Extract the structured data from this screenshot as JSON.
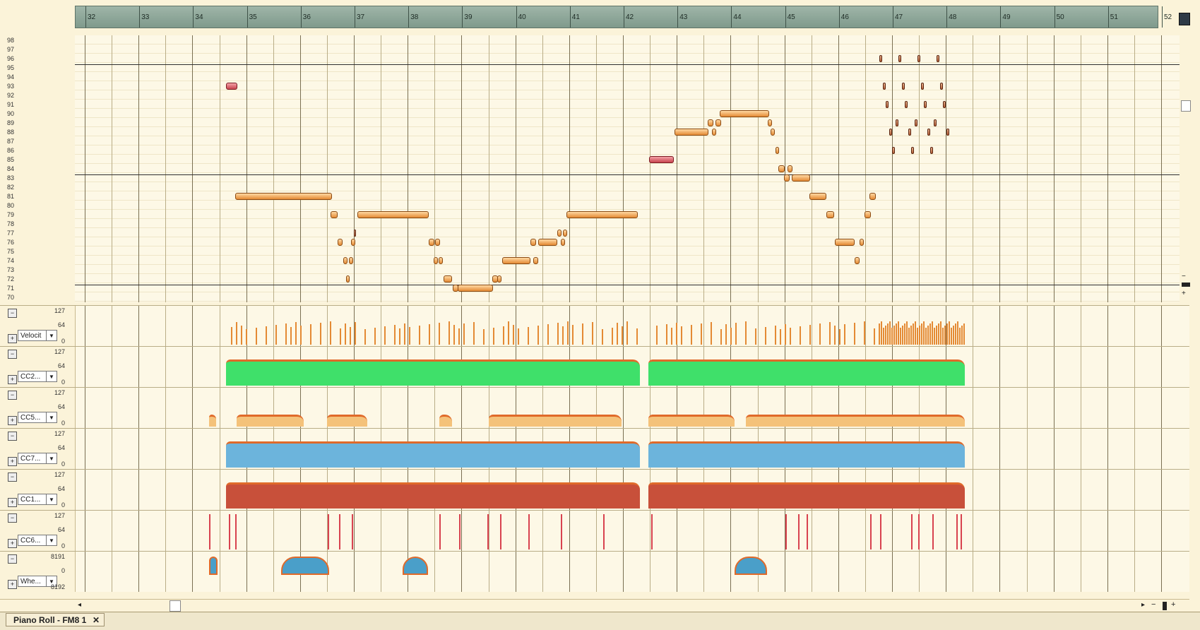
{
  "ruler": {
    "bars": [
      "32",
      "33",
      "34",
      "35",
      "36",
      "37",
      "38",
      "39",
      "40",
      "41",
      "42",
      "43",
      "44",
      "45",
      "46",
      "47",
      "48",
      "49",
      "50",
      "51",
      "52"
    ]
  },
  "piano_roll": {
    "pitch_labels": [
      "98",
      "97",
      "96",
      "95",
      "94",
      "93",
      "92",
      "91",
      "90",
      "89",
      "88",
      "87",
      "86",
      "85",
      "84",
      "83",
      "82",
      "81",
      "80",
      "79",
      "78",
      "77",
      "76",
      "75",
      "74",
      "73",
      "72",
      "71",
      "70"
    ]
  },
  "lanes": [
    {
      "label": "Velocit",
      "max": "127",
      "mid": "64",
      "min": "0",
      "color": "#e48a34"
    },
    {
      "label": "CC2...",
      "max": "127",
      "mid": "64",
      "min": "0",
      "color": "#3fe06a"
    },
    {
      "label": "CC5...",
      "max": "127",
      "mid": "64",
      "min": "0",
      "color": "#f4c27a"
    },
    {
      "label": "CC7...",
      "max": "127",
      "mid": "64",
      "min": "0",
      "color": "#6cb4dc"
    },
    {
      "label": "CC1...",
      "max": "127",
      "mid": "64",
      "min": "0",
      "color": "#c8503a"
    },
    {
      "label": "CC6...",
      "max": "127",
      "mid": "64",
      "min": "0",
      "color": "#d8424f"
    },
    {
      "label": "Whe...",
      "max": "8191",
      "mid": "0",
      "min": "8192",
      "color": "#4a9fc9"
    }
  ],
  "status": {
    "tab_label": "Piano Roll - FM8 1",
    "close": "✕"
  },
  "icons": {
    "plus": "+",
    "minus": "−",
    "dropdown": "▼",
    "left": "◂",
    "right": "▸",
    "zoom_out": "−",
    "zoom_in": "+"
  }
}
